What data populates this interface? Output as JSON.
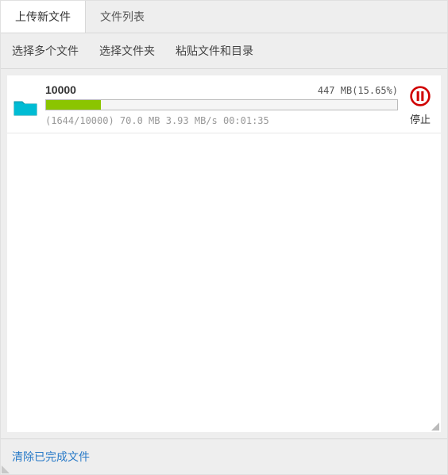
{
  "tabs": {
    "upload_new": "上传新文件",
    "file_list": "文件列表"
  },
  "toolbar": {
    "select_multiple": "选择多个文件",
    "select_folder": "选择文件夹",
    "paste_files": "粘贴文件和目录"
  },
  "upload": {
    "name": "10000",
    "size_text": "447 MB(15.65%)",
    "progress_percent": 15.65,
    "stats": "(1644/10000) 70.0 MB 3.93 MB/s 00:01:35",
    "stop_label": "停止"
  },
  "footer": {
    "clear_completed": "清除已完成文件"
  },
  "colors": {
    "accent": "#8bc500",
    "stop": "#d00000",
    "link": "#2a7bc8"
  }
}
